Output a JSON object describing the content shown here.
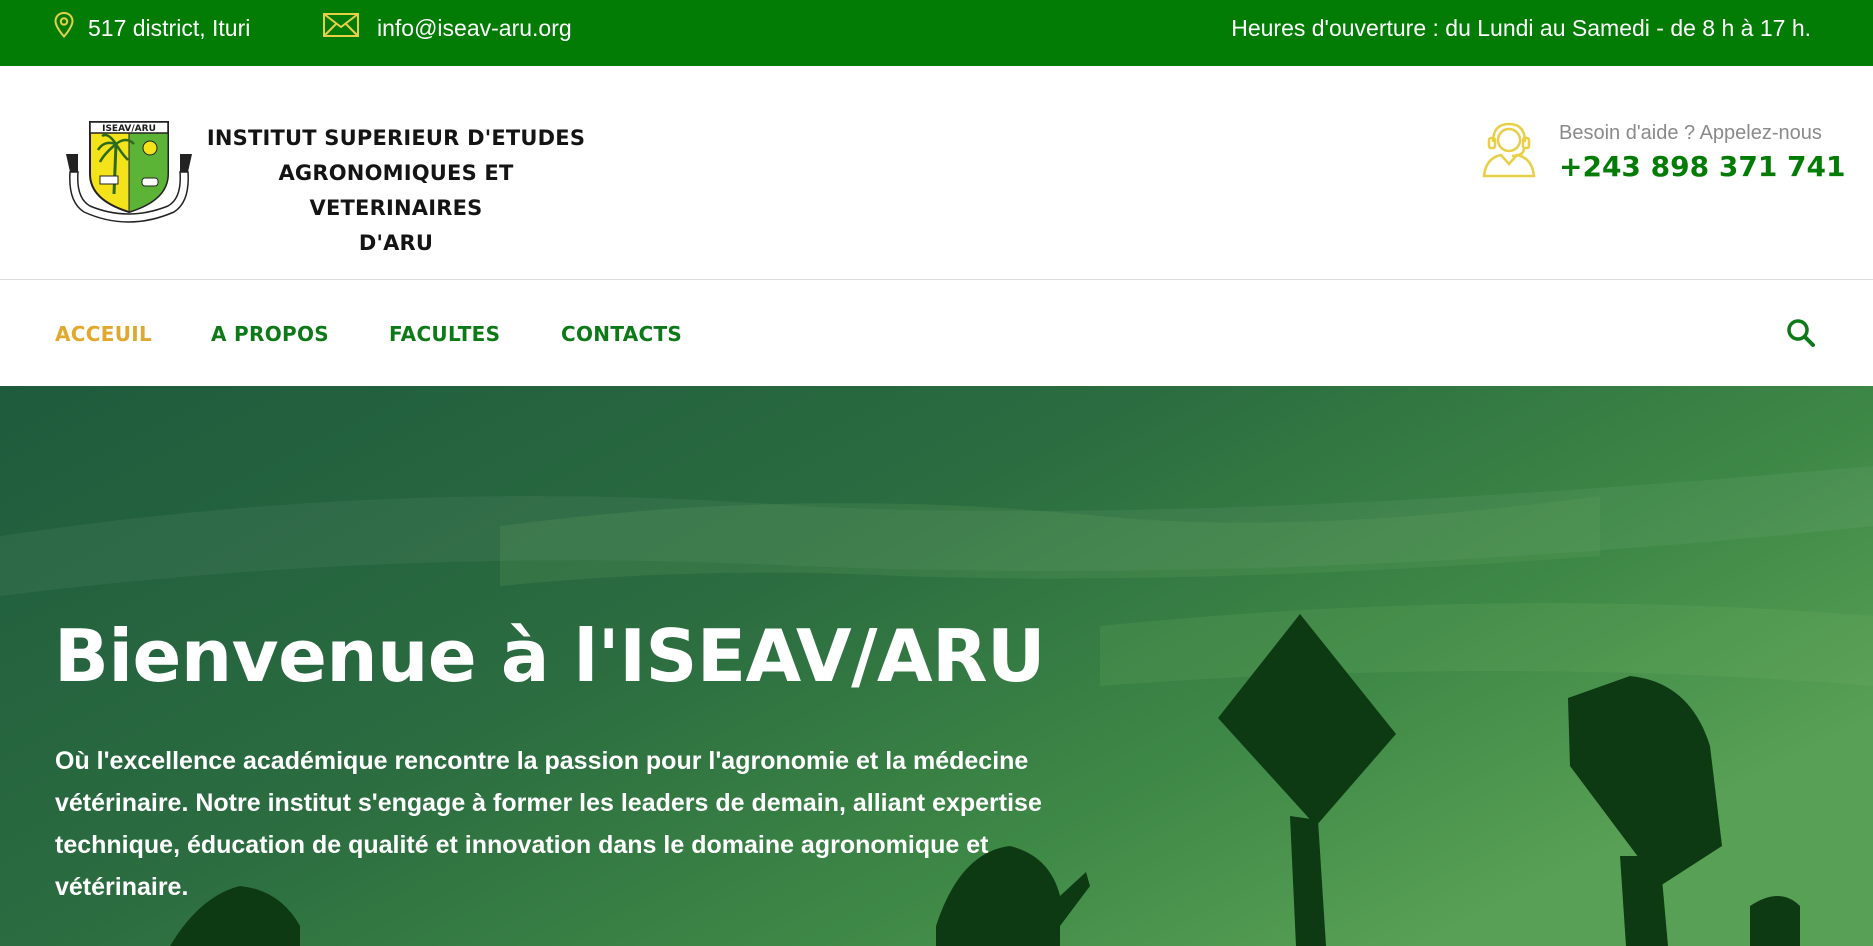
{
  "topbar": {
    "address": "517 district, Ituri",
    "email": "info@iseav-aru.org",
    "hours": "Heures d'ouverture : du Lundi au Samedi - de 8 h à 17 h.",
    "icons": [
      "map-pin-icon",
      "envelope-icon"
    ]
  },
  "header": {
    "logo_text": "ISEAV/ARU",
    "logo_motto": "SCIENTIA SPLENDET ET CONSCIENTIA",
    "institute_name_lines": [
      "INSTITUT SUPERIEUR D'ETUDES",
      "AGRONOMIQUES ET VETERINAIRES",
      "D'ARU"
    ],
    "help_label": "Besoin d'aide ? Appelez-nous",
    "help_phone": "+243 898 371 741"
  },
  "nav": {
    "items": [
      {
        "label": "ACCEUIL",
        "active": true
      },
      {
        "label": "A PROPOS",
        "active": false
      },
      {
        "label": "FACULTES",
        "active": false
      },
      {
        "label": "CONTACTS",
        "active": false
      }
    ],
    "search_icon": "search-icon"
  },
  "hero": {
    "title": "Bienvenue à l'ISEAV/ARU",
    "text": "Où l'excellence académique rencontre la passion pour l'agronomie et la médecine vétérinaire. Notre institut s'engage à former les leaders de demain, alliant expertise technique, éducation de qualité et innovation dans le domaine agronomique et vétérinaire."
  },
  "colors": {
    "brand_green": "#037c05",
    "nav_green": "#0c7a17",
    "accent_gold": "#e2a72d",
    "icon_yellow": "#e8cf45"
  }
}
